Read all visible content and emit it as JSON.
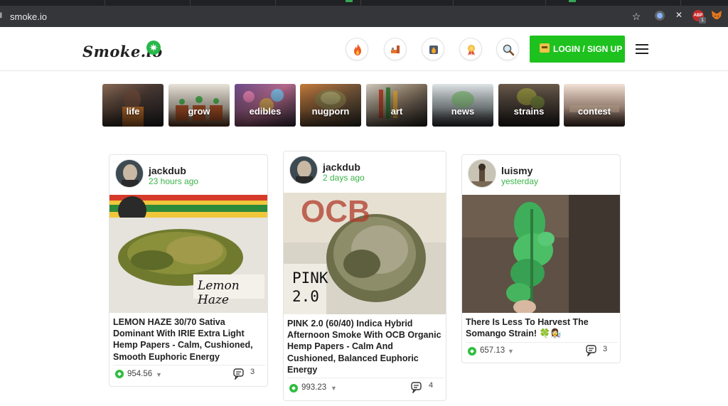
{
  "browser": {
    "url": "smoke.io",
    "ext_badge": "1"
  },
  "header": {
    "logo": "Smoke.io",
    "login_label": "LOGIN / SIGN UP",
    "icons": [
      "fire-icon",
      "hot-icon",
      "promoted-icon",
      "award-icon",
      "search-icon"
    ]
  },
  "categories": [
    {
      "label": "life"
    },
    {
      "label": "grow"
    },
    {
      "label": "edibles"
    },
    {
      "label": "nugporn"
    },
    {
      "label": "art"
    },
    {
      "label": "news"
    },
    {
      "label": "strains"
    },
    {
      "label": "contest"
    }
  ],
  "posts": [
    {
      "author": "jackdub",
      "time": "23 hours ago",
      "title": "LEMON HAZE 30/70 Sativa Dominant With IRIE Extra Light Hemp Papers - Calm, Cushioned, Smooth Euphoric Energy",
      "image_caption": "Lemon Haze",
      "payout": "954.56",
      "comments": "3"
    },
    {
      "author": "jackdub",
      "time": "2 days ago",
      "title": "PINK 2.0 (60/40) Indica Hybrid Afternoon Smoke With OCB Organic Hemp Papers - Calm And Cushioned, Balanced Euphoric Energy",
      "image_caption_1": "PINK",
      "image_caption_2": "2.0",
      "image_brand": "OCB",
      "payout": "993.23",
      "comments": "4"
    },
    {
      "author": "luismy",
      "time": "yesterday",
      "title": "There Is Less To Harvest The Somango Strain! 🍀👩‍🔬",
      "payout": "657.13",
      "comments": "3"
    }
  ],
  "colors": {
    "accent": "#1ec21e",
    "time_text": "#3bb34a"
  }
}
